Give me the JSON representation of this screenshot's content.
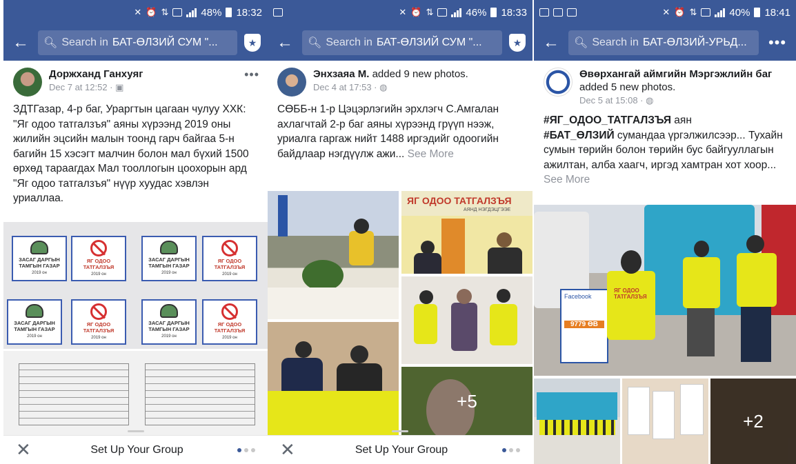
{
  "screens": [
    {
      "status": {
        "battery": "48%",
        "time": "18:32"
      },
      "search": {
        "prefix": "Search in ",
        "target": "БАТ-ӨЛЗИЙ СУМ \"..."
      },
      "post": {
        "author": "Доржханд Ганхуяг",
        "action": "",
        "meta": "Dec 7 at 12:52 · ▣",
        "text": "ЗДТГазар, 4-р баг, Ураргтын цагаан чулуу ХХК:  \"Яг одоо татгалзъя\" аяны хүрээнд 2019 оны жилийн эцсийн малын тоонд гарч байгаа 5-н багийн 15 хэсэгт малчин болон мал бүхий 1500 өрхөд тараагдах Мал тооллогын цоохорын ард \"Яг одоо татгалзъя\" нүүр хуудас хэвлэн уриаллаа.",
        "see_more": ""
      },
      "images": {
        "cards": [
          {
            "line1": "ЗАСАГ ДАРГЫН",
            "line2": "ТАМГЫН ГАЗАР",
            "year": "2019 он"
          },
          {
            "line1": "ЯГ ОДОО",
            "line2": "ТАТГАЛЗЪЯ",
            "year": "2019 он"
          }
        ]
      },
      "bottombar": {
        "title": "Set Up Your Group"
      }
    },
    {
      "status": {
        "battery": "46%",
        "time": "18:33"
      },
      "search": {
        "prefix": "Search in ",
        "target": "БАТ-ӨЛЗИЙ СУМ \"..."
      },
      "post": {
        "author": "Энхзаяа М.",
        "action": " added 9 new photos.",
        "meta": "Dec 4 at 17:53 · ◍",
        "text": "СӨББ-н 1-р Цэцэрлэгийн эрхлэгч С.Амгалан ахлагчтай 2-р баг аяны хүрээнд грүүп нээж, уриалга гаргаж нийт 1488 иргэдийг одоогийн байдлаар нэгдүүлж  ажи...",
        "see_more": " See More"
      },
      "images": {
        "banner": "ЯГ ОДОО ТАТГАЛЗЪЯ",
        "banner_sub": "АЯНД НЭГДЭЦГЭЭЕ",
        "more_count": "+5"
      },
      "bottombar": {
        "title": "Set Up Your Group"
      }
    },
    {
      "status": {
        "battery": "40%",
        "time": "18:41"
      },
      "search": {
        "prefix": "Search in ",
        "target": "БАТ-ӨЛЗИЙ-УРЬД..."
      },
      "post": {
        "author": "Өвөрхангай аймгийн Мэргэжлийн баг",
        "action": " added 5 new photos.",
        "meta": "Dec 5 at 15:08 · ◍",
        "hashtag1": "#ЯГ_ОДОО_ТАТГАЛЗЪЯ",
        "after1": " аян",
        "hashtag2": "#БАТ_ӨЛЗИЙ",
        "after2": " сумандаа үргэлжилсээр... Тухайн сумын төрийн болон төрийн бус байгууллагын ажилтан, алба хаагч, иргэд хамтран хот хоор...",
        "see_more": " See More"
      },
      "images": {
        "vest_text": "ЯГ ОДОО ТАТГАЛЗЪЯ",
        "plate": "9779 ӨВ",
        "facebook": "Facebook",
        "more_count": "+2"
      }
    }
  ]
}
